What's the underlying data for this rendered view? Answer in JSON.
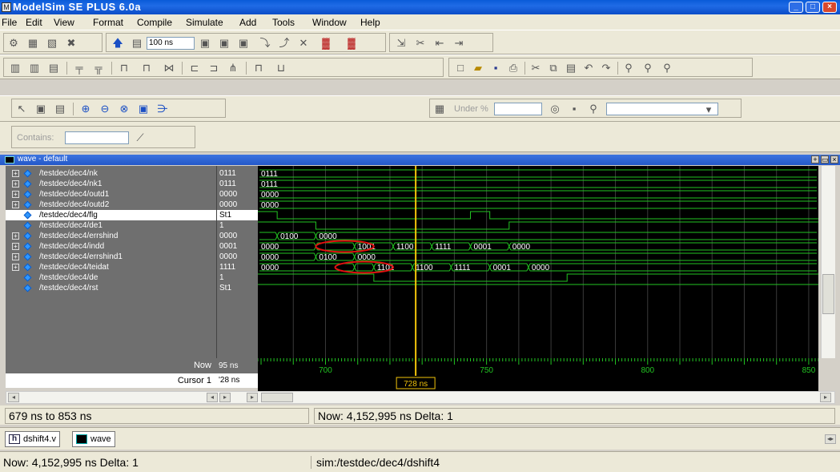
{
  "window": {
    "title": "ModelSim SE PLUS 6.0a"
  },
  "menu": [
    "File",
    "Edit",
    "View",
    "Format",
    "Compile",
    "Simulate",
    "Add",
    "Tools",
    "Window",
    "Help"
  ],
  "toolbar": {
    "run_length": "100 ns",
    "under_label": "Under %",
    "contains_label": "Contains:"
  },
  "wave": {
    "title": "wave - default",
    "signals": [
      {
        "name": "/testdec/dec4/nk",
        "value": "0111",
        "expandable": true
      },
      {
        "name": "/testdec/dec4/nk1",
        "value": "0111",
        "expandable": true
      },
      {
        "name": "/testdec/dec4/outd1",
        "value": "0000",
        "expandable": true
      },
      {
        "name": "/testdec/dec4/outd2",
        "value": "0000",
        "expandable": true
      },
      {
        "name": "/testdec/dec4/flg",
        "value": "St1",
        "expandable": false
      },
      {
        "name": "/testdec/dec4/de1",
        "value": "1",
        "expandable": false
      },
      {
        "name": "/testdec/dec4/errshind",
        "value": "0000",
        "expandable": true
      },
      {
        "name": "/testdec/dec4/indd",
        "value": "0001",
        "expandable": true
      },
      {
        "name": "/testdec/dec4/errshind1",
        "value": "0000",
        "expandable": true
      },
      {
        "name": "/testdec/dec4/teidat",
        "value": "1111",
        "expandable": true
      },
      {
        "name": "/testdec/dec4/de",
        "value": "1",
        "expandable": false
      },
      {
        "name": "/testdec/dec4/rst",
        "value": "St1",
        "expandable": false
      }
    ],
    "now_label": "Now",
    "now_value": "95 ns",
    "cursor_label": "Cursor 1",
    "cursor_value": "'28 ns",
    "cursor_time_label": "728 ns",
    "timeline": {
      "range": [
        679,
        853
      ],
      "ticks": [
        "700",
        "750",
        "800",
        "850"
      ],
      "cursor_time": 728
    },
    "bus_waves": [
      {
        "row": 0,
        "segments": [
          {
            "t": 679,
            "label": "0111"
          }
        ]
      },
      {
        "row": 1,
        "segments": [
          {
            "t": 679,
            "label": "0111"
          }
        ]
      },
      {
        "row": 2,
        "segments": [
          {
            "t": 679,
            "label": "0000"
          }
        ]
      },
      {
        "row": 3,
        "segments": [
          {
            "t": 679,
            "label": "0000"
          }
        ]
      },
      {
        "row": 6,
        "segments": [
          {
            "t": 679,
            "label": ""
          },
          {
            "t": 685,
            "label": "0100"
          },
          {
            "t": 697,
            "label": "0000"
          }
        ]
      },
      {
        "row": 7,
        "segments": [
          {
            "t": 679,
            "label": "0000"
          },
          {
            "t": 697,
            "label": ""
          },
          {
            "t": 709,
            "label": "1001"
          },
          {
            "t": 721,
            "label": "1100"
          },
          {
            "t": 733,
            "label": "1111"
          },
          {
            "t": 745,
            "label": "0001"
          },
          {
            "t": 757,
            "label": "0000"
          }
        ]
      },
      {
        "row": 8,
        "segments": [
          {
            "t": 679,
            "label": "0000"
          },
          {
            "t": 697,
            "label": "0100"
          },
          {
            "t": 709,
            "label": "0000"
          }
        ]
      },
      {
        "row": 9,
        "segments": [
          {
            "t": 679,
            "label": "0000"
          },
          {
            "t": 709,
            "label": ""
          },
          {
            "t": 715,
            "label": "1101"
          },
          {
            "t": 727,
            "label": "1100"
          },
          {
            "t": 739,
            "label": "1111"
          },
          {
            "t": 751,
            "label": "0001"
          },
          {
            "t": 763,
            "label": "0000"
          }
        ]
      }
    ],
    "bit_waves": [
      {
        "row": 4,
        "points": [
          [
            679,
            1
          ],
          [
            685,
            0
          ],
          [
            745,
            1
          ],
          [
            751,
            0
          ],
          [
            853,
            0
          ]
        ]
      },
      {
        "row": 5,
        "points": [
          [
            679,
            1
          ],
          [
            697,
            0
          ],
          [
            757,
            1
          ],
          [
            853,
            1
          ]
        ]
      },
      {
        "row": 10,
        "points": [
          [
            679,
            1
          ],
          [
            715,
            0
          ],
          [
            775,
            1
          ],
          [
            853,
            1
          ]
        ]
      },
      {
        "row": 11,
        "points": [
          [
            679,
            1
          ],
          [
            853,
            1
          ]
        ]
      }
    ],
    "highlights": [
      {
        "row": 7,
        "t0": 697,
        "t1": 715
      },
      {
        "row": 9,
        "t0": 703,
        "t1": 721
      }
    ]
  },
  "status": {
    "range": "679 ns to 853 ns",
    "now_delta": "Now: 4,152,995 ns   Delta: 1"
  },
  "tabs": [
    "dshift4.v",
    "wave"
  ],
  "bottom": {
    "now_delta": "Now: 4,152,995 ns   Delta: 1",
    "path": "sim:/testdec/dec4/dshift4"
  }
}
